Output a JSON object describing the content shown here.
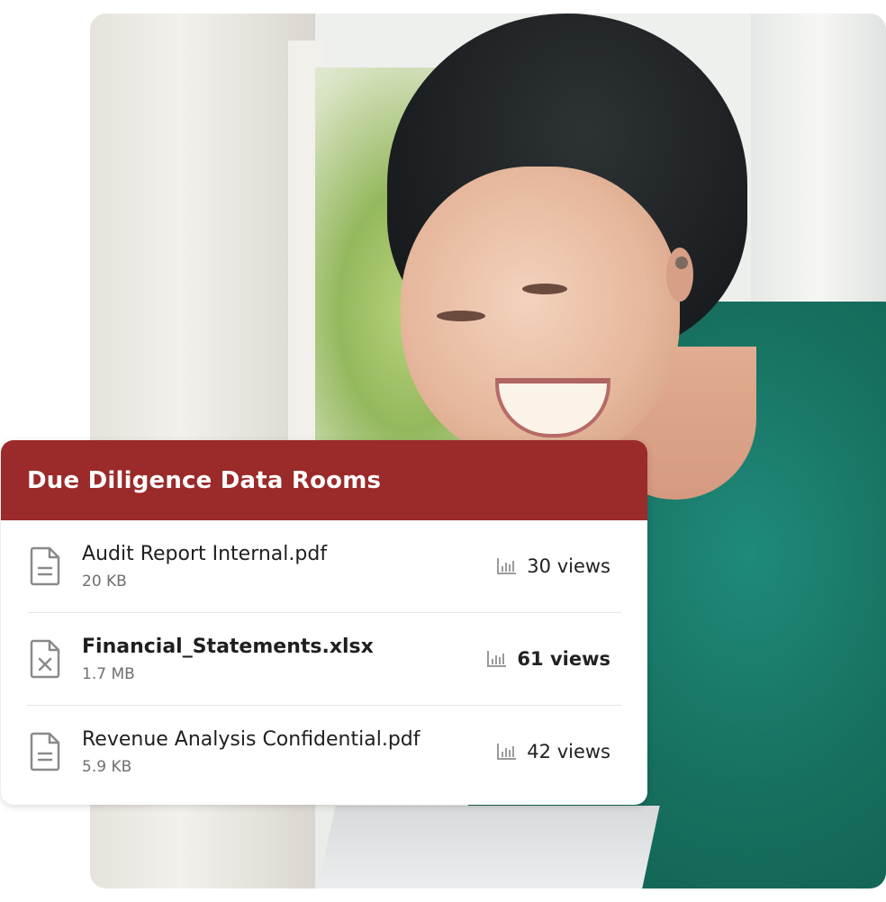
{
  "card": {
    "title": "Due Diligence Data Rooms",
    "accent_color": "#9b2a2a",
    "files": [
      {
        "name": "Audit Report Internal.pdf",
        "size": "20 KB",
        "views": "30 views",
        "icon": "pdf-document-icon",
        "highlight": false
      },
      {
        "name": "Financial_Statements.xlsx",
        "size": "1.7 MB",
        "views": "61 views",
        "icon": "spreadsheet-document-icon",
        "highlight": true
      },
      {
        "name": "Revenue Analysis Confidential.pdf",
        "size": "5.9 KB",
        "views": "42 views",
        "icon": "pdf-document-icon",
        "highlight": false
      }
    ]
  },
  "icons": {
    "views": "bar-chart-icon"
  }
}
